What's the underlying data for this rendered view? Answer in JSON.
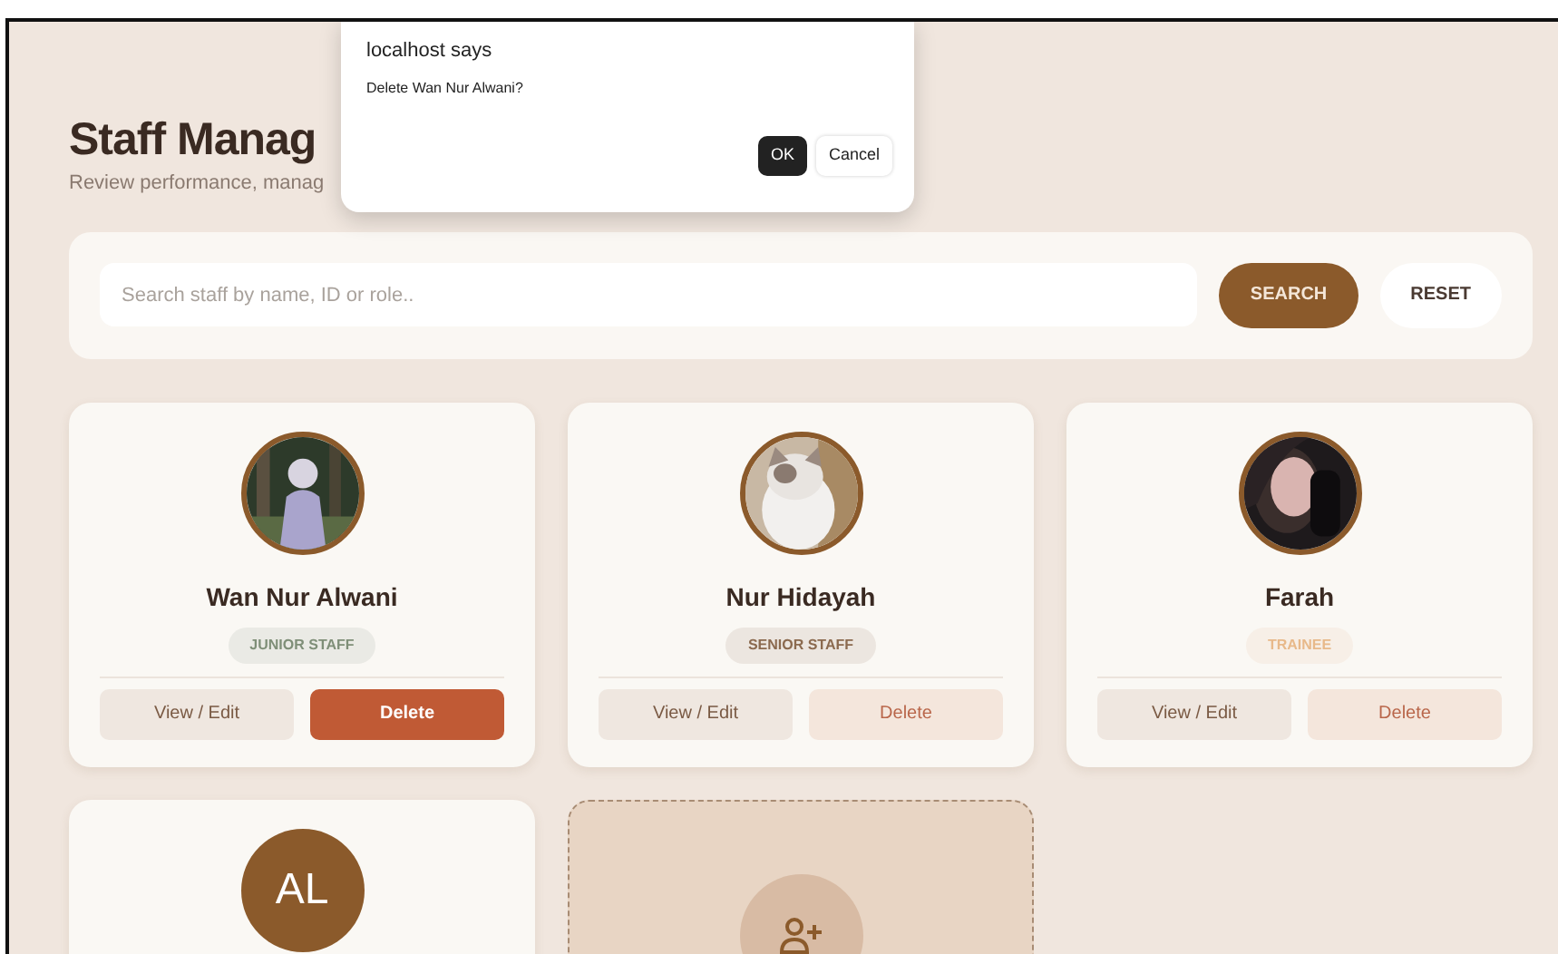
{
  "header": {
    "title": "Staff Manag",
    "subtitle": "Review performance, manag"
  },
  "search": {
    "placeholder": "Search staff by name, ID or role..",
    "buttons": [
      {
        "label": "SEARCH",
        "kind": "primary"
      },
      {
        "label": "RESET",
        "kind": "plain"
      }
    ]
  },
  "staff": [
    {
      "name": "Wan Nur Alwani",
      "role": "JUNIOR STAFF",
      "color": "#7f8f78",
      "view_label": "View / Edit",
      "delete_label": "Delete",
      "delete_active": true
    },
    {
      "name": "Nur Hidayah",
      "role": "SENIOR STAFF",
      "color": "#8b6a4f",
      "view_label": "View / Edit",
      "delete_label": "Delete",
      "delete_active": false
    },
    {
      "name": "Farah",
      "role": "TRAINEE",
      "color": "#e8b98a",
      "view_label": "View / Edit",
      "delete_label": "Delete",
      "delete_active": false
    },
    {
      "avatar": {
        "kind": "initials",
        "text": "AL"
      }
    }
  ],
  "add_card": {
    "shown": true
  },
  "dialog": {
    "title": "localhost says",
    "message": "Delete Wan Nur Alwani?",
    "buttons": [
      {
        "label": "OK",
        "kind": "primary"
      },
      {
        "label": "Cancel",
        "kind": "plain"
      }
    ]
  }
}
